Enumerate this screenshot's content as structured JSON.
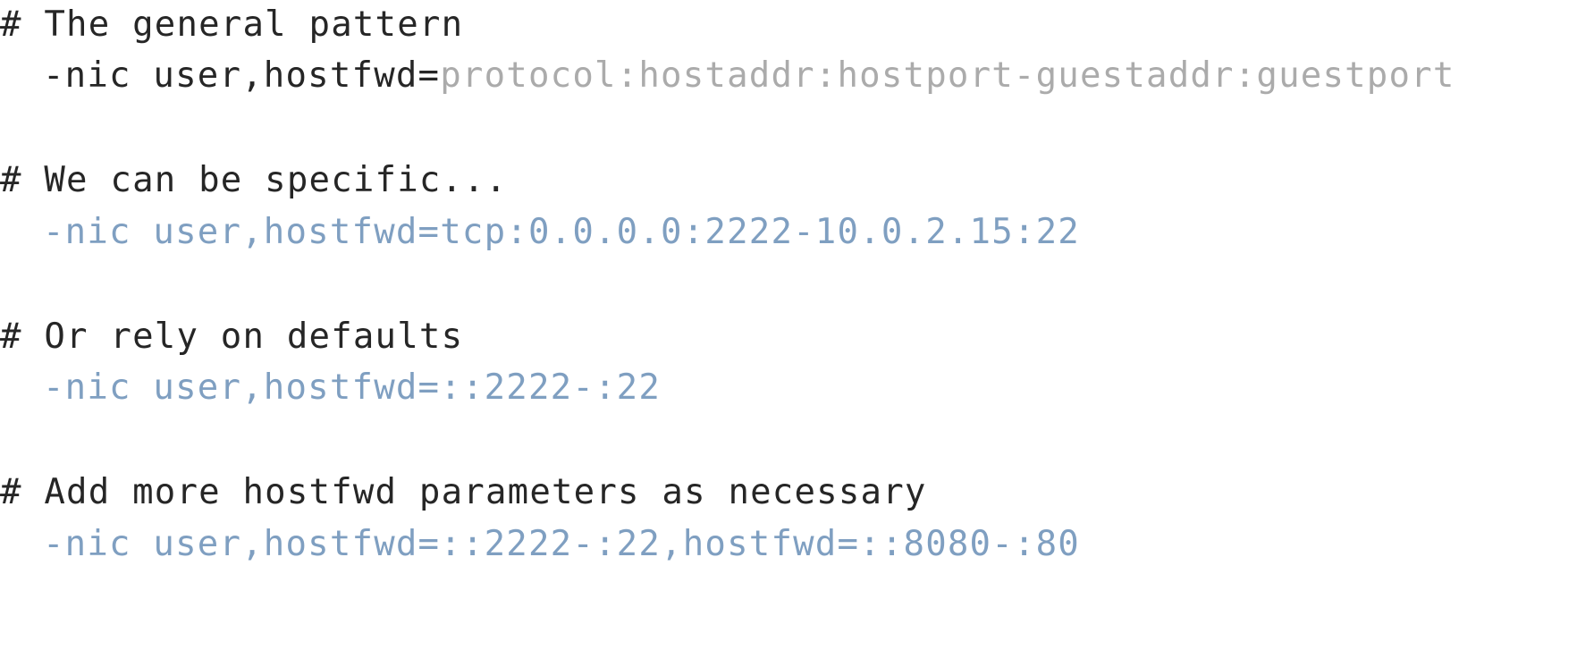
{
  "lines": [
    {
      "comment": "# The general pattern"
    },
    {
      "cmd_prefix": "-nic user,hostfwd=",
      "cmd_rest": "protocol:hostaddr:hostport-guestaddr:guestport"
    },
    {
      "comment": "# We can be specific..."
    },
    {
      "cmd": "-nic user,hostfwd=tcp:0.0.0.0:2222-10.0.2.15:22"
    },
    {
      "comment": "# Or rely on defaults"
    },
    {
      "cmd": "-nic user,hostfwd=::2222-:22"
    },
    {
      "comment": "# Add more hostfwd parameters as necessary"
    },
    {
      "cmd": "-nic user,hostfwd=::2222-:22,hostfwd=::8080-:80"
    }
  ],
  "colors": {
    "text": "#262626",
    "placeholder": "#ababab",
    "example": "#7f9fc1",
    "background": "#ffffff"
  }
}
